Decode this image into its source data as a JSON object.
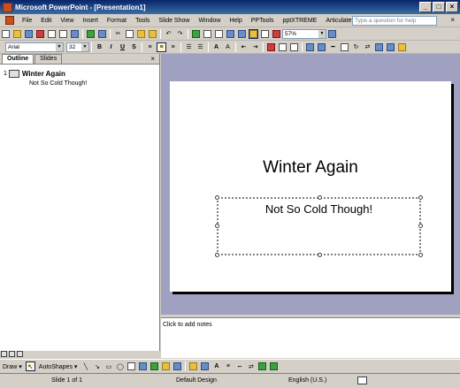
{
  "window": {
    "title": "Microsoft PowerPoint - [Presentation1]"
  },
  "menubar": {
    "items": [
      "File",
      "Edit",
      "View",
      "Insert",
      "Format",
      "Tools",
      "Slide Show",
      "Window",
      "Help",
      "PPTools",
      "pptXTREME",
      "Articulate"
    ],
    "help_placeholder": "Type a question for help"
  },
  "toolbar": {
    "zoom": "57%",
    "font_name": "Arial",
    "font_size": "32"
  },
  "left_pane": {
    "tabs": [
      "Outline",
      "Slides"
    ],
    "active_tab": "Outline",
    "slides": [
      {
        "number": "1",
        "title": "Winter Again",
        "subtitle": "Not So Cold Though!"
      }
    ]
  },
  "slide": {
    "title": "Winter Again",
    "subtitle": "Not So Cold Though!"
  },
  "notes": {
    "placeholder": "Click to add notes"
  },
  "drawbar": {
    "draw_label": "Draw ▾",
    "autoshapes_label": "AutoShapes ▾"
  },
  "status": {
    "slide_position": "Slide 1 of 1",
    "design": "Default Design",
    "language": "English (U.S.)"
  },
  "colors": {
    "title_bar": "#0a246a",
    "workspace": "#a0a0c0",
    "chrome": "#d4d0c8"
  }
}
